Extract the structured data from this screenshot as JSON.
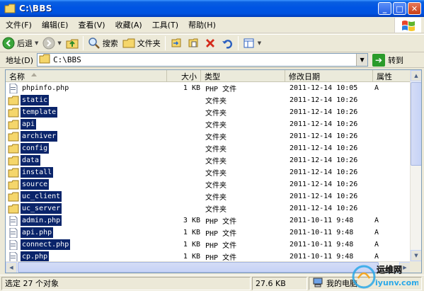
{
  "window": {
    "title": "C:\\BBS"
  },
  "menu": {
    "items": [
      "文件(F)",
      "编辑(E)",
      "查看(V)",
      "收藏(A)",
      "工具(T)",
      "帮助(H)"
    ]
  },
  "toolbar": {
    "back_label": "后退",
    "search_label": "搜索",
    "folders_label": "文件夹"
  },
  "address": {
    "label": "地址(D)",
    "value": "C:\\BBS",
    "go_label": "转到"
  },
  "columns": {
    "name": "名称",
    "size": "大小",
    "type": "类型",
    "modified": "修改日期",
    "attributes": "属性"
  },
  "files": [
    {
      "name": "phpinfo.php",
      "size": "1 KB",
      "type": "PHP 文件",
      "modified": "2011-12-14 10:05",
      "attr": "A",
      "kind": "php",
      "selected": false
    },
    {
      "name": "static",
      "size": "",
      "type": "文件夹",
      "modified": "2011-12-14 10:26",
      "attr": "",
      "kind": "folder",
      "selected": true
    },
    {
      "name": "template",
      "size": "",
      "type": "文件夹",
      "modified": "2011-12-14 10:26",
      "attr": "",
      "kind": "folder",
      "selected": true
    },
    {
      "name": "api",
      "size": "",
      "type": "文件夹",
      "modified": "2011-12-14 10:26",
      "attr": "",
      "kind": "folder",
      "selected": true
    },
    {
      "name": "archiver",
      "size": "",
      "type": "文件夹",
      "modified": "2011-12-14 10:26",
      "attr": "",
      "kind": "folder",
      "selected": true
    },
    {
      "name": "config",
      "size": "",
      "type": "文件夹",
      "modified": "2011-12-14 10:26",
      "attr": "",
      "kind": "folder",
      "selected": true
    },
    {
      "name": "data",
      "size": "",
      "type": "文件夹",
      "modified": "2011-12-14 10:26",
      "attr": "",
      "kind": "folder",
      "selected": true
    },
    {
      "name": "install",
      "size": "",
      "type": "文件夹",
      "modified": "2011-12-14 10:26",
      "attr": "",
      "kind": "folder",
      "selected": true
    },
    {
      "name": "source",
      "size": "",
      "type": "文件夹",
      "modified": "2011-12-14 10:26",
      "attr": "",
      "kind": "folder",
      "selected": true
    },
    {
      "name": "uc_client",
      "size": "",
      "type": "文件夹",
      "modified": "2011-12-14 10:26",
      "attr": "",
      "kind": "folder",
      "selected": true
    },
    {
      "name": "uc_server",
      "size": "",
      "type": "文件夹",
      "modified": "2011-12-14 10:26",
      "attr": "",
      "kind": "folder",
      "selected": true
    },
    {
      "name": "admin.php",
      "size": "3 KB",
      "type": "PHP 文件",
      "modified": "2011-10-11 9:48",
      "attr": "A",
      "kind": "php",
      "selected": true
    },
    {
      "name": "api.php",
      "size": "1 KB",
      "type": "PHP 文件",
      "modified": "2011-10-11 9:48",
      "attr": "A",
      "kind": "php",
      "selected": true
    },
    {
      "name": "connect.php",
      "size": "1 KB",
      "type": "PHP 文件",
      "modified": "2011-10-11 9:48",
      "attr": "A",
      "kind": "php",
      "selected": true
    },
    {
      "name": "cp.php",
      "size": "1 KB",
      "type": "PHP 文件",
      "modified": "2011-10-11 9:48",
      "attr": "A",
      "kind": "php",
      "selected": true
    }
  ],
  "status": {
    "selection": "选定 27 个对象",
    "size": "27.6 KB",
    "location": "我的电脑"
  },
  "watermark": {
    "line1": "运维网",
    "line2": "iyunv.com"
  },
  "colors": {
    "selection": "#0a246a",
    "titlebar": "#0054e3",
    "folder": "#f5d66b"
  }
}
